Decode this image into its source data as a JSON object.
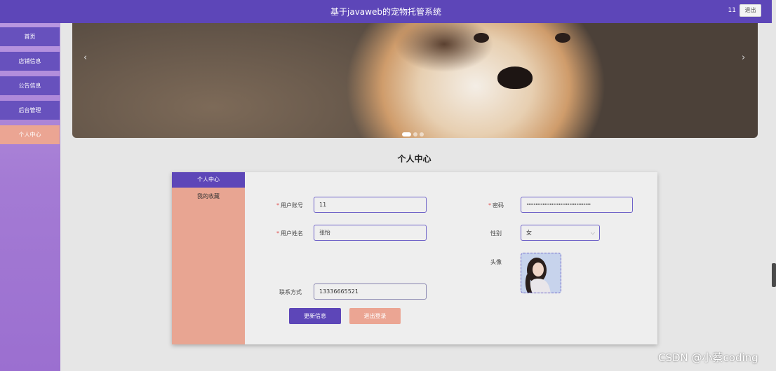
{
  "header": {
    "title": "基于javaweb的宠物托管系统",
    "username": "11",
    "logout_label": "退出"
  },
  "sidebar": {
    "items": [
      {
        "label": "首页"
      },
      {
        "label": "店铺信息"
      },
      {
        "label": "公告信息"
      },
      {
        "label": "后台管理"
      },
      {
        "label": "个人中心"
      }
    ]
  },
  "banner": {
    "prev_icon": "chevron-left-icon",
    "next_icon": "chevron-right-icon",
    "prev_glyph": "‹",
    "next_glyph": "›"
  },
  "page": {
    "title": "个人中心"
  },
  "profile_tabs": [
    {
      "label": "个人中心"
    },
    {
      "label": "我的收藏"
    }
  ],
  "form": {
    "required_mark": "*",
    "account": {
      "label": "用户账号",
      "value": "11"
    },
    "password": {
      "label": "密码",
      "value": "••••••••••••••••••••••••••••••••••••"
    },
    "name": {
      "label": "用户姓名",
      "value": "张怡"
    },
    "gender": {
      "label": "性别",
      "value": "女",
      "chevron": "⌵"
    },
    "avatar": {
      "label": "头像"
    },
    "phone": {
      "label": "联系方式",
      "value": "13336665521"
    },
    "update_label": "更新信息",
    "logout_label": "退出登录"
  },
  "watermark": "CSDN @小蔡coding",
  "colors": {
    "primary": "#5d46b8",
    "accent": "#eba593",
    "sidebar_bg": "#a47bd4"
  }
}
